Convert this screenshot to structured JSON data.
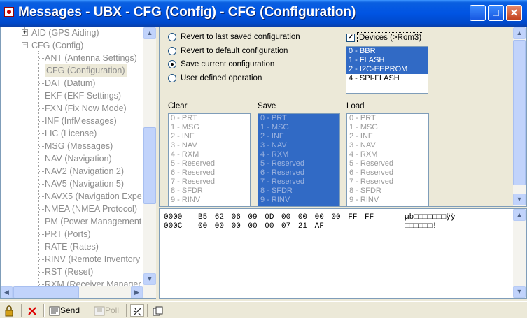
{
  "window": {
    "title": "Messages - UBX - CFG (Config) - CFG (Configuration)",
    "minimize": "_",
    "maximize": "□",
    "close": "✕"
  },
  "tree": {
    "items": [
      {
        "label": "AID (GPS Aiding)",
        "expander": "+"
      },
      {
        "label": "CFG (Config)",
        "expander": "−"
      },
      {
        "label": "ANT (Antenna Settings)"
      },
      {
        "label": "CFG (Configuration)",
        "selected": true
      },
      {
        "label": "DAT (Datum)"
      },
      {
        "label": "EKF (EKF Settings)"
      },
      {
        "label": "FXN (Fix Now Mode)"
      },
      {
        "label": "INF (InfMessages)"
      },
      {
        "label": "LIC (License)"
      },
      {
        "label": "MSG (Messages)"
      },
      {
        "label": "NAV (Navigation)"
      },
      {
        "label": "NAV2 (Navigation 2)"
      },
      {
        "label": "NAV5 (Navigation 5)"
      },
      {
        "label": "NAVX5 (Navigation Expe"
      },
      {
        "label": "NMEA (NMEA Protocol)"
      },
      {
        "label": "PM (Power Management"
      },
      {
        "label": "PRT (Ports)"
      },
      {
        "label": "RATE (Rates)"
      },
      {
        "label": "RINV (Remote Inventory"
      },
      {
        "label": "RST (Reset)"
      },
      {
        "label": "RXM (Receiver Manager"
      }
    ]
  },
  "options": {
    "radios": [
      {
        "label": "Revert to last saved configuration",
        "checked": false
      },
      {
        "label": "Revert to default configuration",
        "checked": false
      },
      {
        "label": "Save current configuration",
        "checked": true
      },
      {
        "label": "User defined operation",
        "checked": false
      }
    ],
    "devices_label": "Devices (>Rom3)",
    "devices_check": "✓",
    "devices": [
      {
        "label": "0 - BBR",
        "selected": true
      },
      {
        "label": "1 - FLASH",
        "selected": true
      },
      {
        "label": "2 - I2C-EEPROM",
        "selected": true
      },
      {
        "label": "4 - SPI-FLASH",
        "selected": false
      }
    ]
  },
  "groups": {
    "clear_label": "Clear",
    "save_label": "Save",
    "load_label": "Load",
    "items": [
      "0 - PRT",
      "1 - MSG",
      "2 - INF",
      "3 - NAV",
      "4 - RXM",
      "5 - Reserved",
      "6 - Reserved",
      "7 - Reserved",
      "8 - SFDR",
      "9 - RINV"
    ]
  },
  "hex": {
    "lines": [
      {
        "offset": "0000",
        "bytes": "B5 62 06 09 0D 00 00 00 00 FF FF",
        "ascii": "µb□□□□□□□ÿÿ"
      },
      {
        "offset": "000C",
        "bytes": "00 00 00 00 00 07 21 AF",
        "ascii": "□□□□□□!¯"
      }
    ]
  },
  "toolbar": {
    "send": "Send",
    "poll": "Poll"
  }
}
